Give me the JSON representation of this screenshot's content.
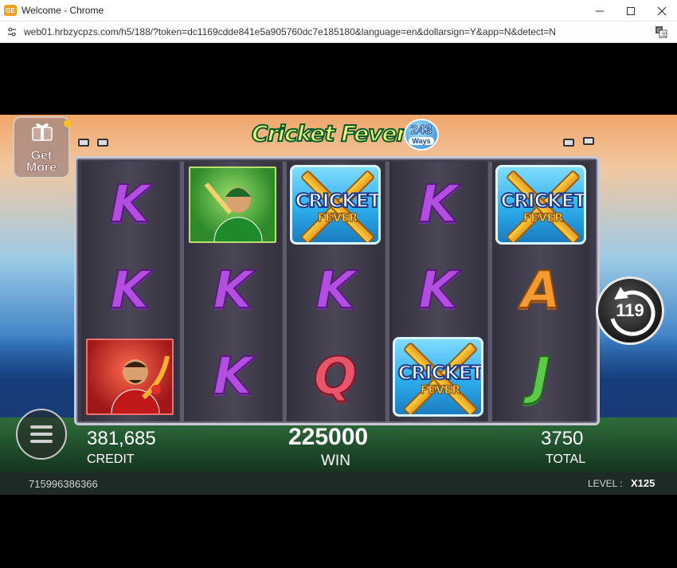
{
  "window": {
    "title": "Welcome - Chrome",
    "url": "web01.hrbzycpzs.com/h5/188/?token=dc1169cdde841e5a905760dc7e185180&language=en&dollarsign=Y&app=N&detect=N",
    "controls": [
      "minimize",
      "maximize",
      "close"
    ]
  },
  "game": {
    "logo": {
      "title": "Cricket Fever",
      "ways_number": "243",
      "ways_label": "Ways"
    },
    "get_more": {
      "line1": "Get",
      "line2": "More"
    },
    "reels": [
      [
        "K",
        "K",
        "player-red"
      ],
      [
        "player-green",
        "K",
        "K"
      ],
      [
        "scatter",
        "K",
        "Q"
      ],
      [
        "K",
        "K",
        "scatter"
      ],
      [
        "scatter",
        "A",
        "J"
      ]
    ],
    "scatter_text": {
      "line1": "CRICKET",
      "line2": "FEVER"
    },
    "colors": {
      "K": "#b34fe0",
      "Q": "#e8556a",
      "A": "#f59a30",
      "J": "#5ec84a"
    },
    "spin": {
      "count": "119",
      "icon": "autospin-arrow-icon"
    },
    "menu_icon": "hamburger-menu-icon",
    "stats": {
      "credit_value": "381,685",
      "credit_label": "CREDIT",
      "win_value": "225000",
      "win_label": "WIN",
      "total_value": "3750",
      "total_label": "TOTAL"
    },
    "footer": {
      "session_id": "715996386366",
      "level_label": "LEVEL :",
      "level_value": "X125"
    }
  }
}
